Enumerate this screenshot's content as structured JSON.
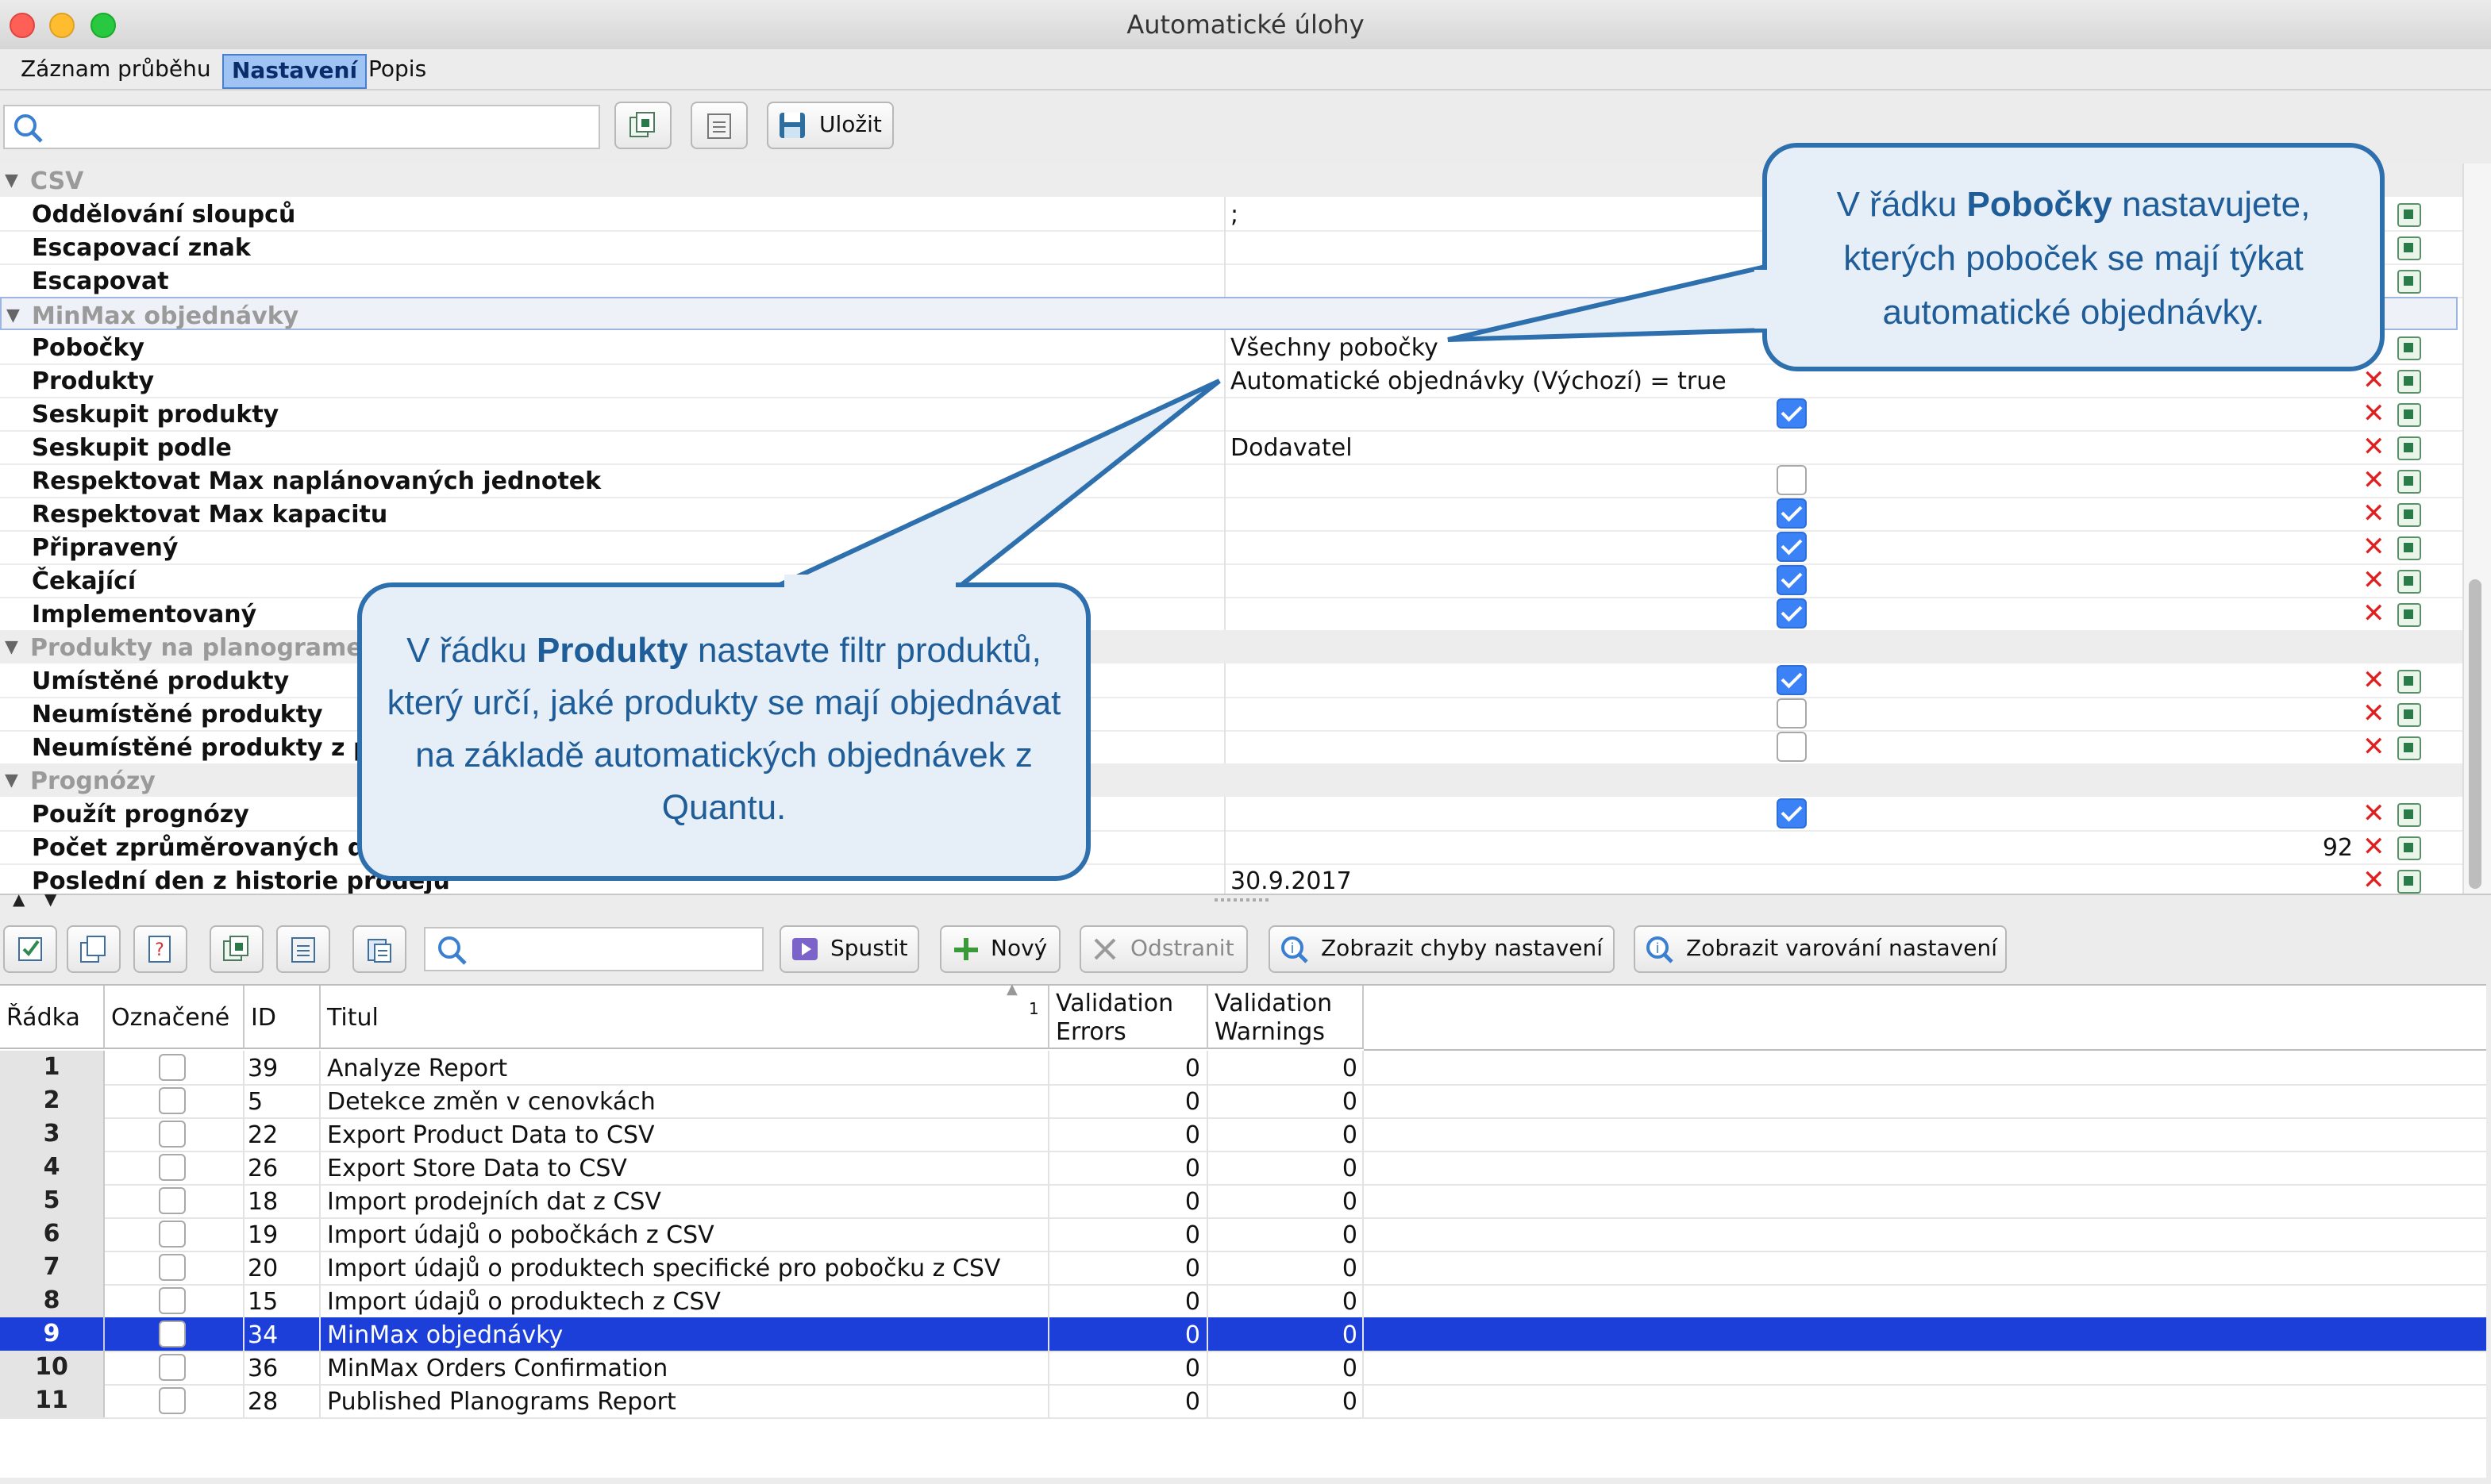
{
  "window": {
    "title": "Automatické úlohy"
  },
  "tabs": [
    {
      "label": "Záznam průběhu"
    },
    {
      "label": "Nastavení"
    },
    {
      "label": "Popis"
    }
  ],
  "toolbar1": {
    "save_label": "Uložit"
  },
  "settings": {
    "groups": {
      "csv": "CSV",
      "minmax": "MinMax objednávky",
      "planogram": "Produkty na planogrameč",
      "forecast": "Prognózy"
    },
    "rows": {
      "separator": {
        "name": "Oddělování sloupců",
        "value": ";"
      },
      "escape_char": {
        "name": "Escapovací znak"
      },
      "escape": {
        "name": "Escapovat"
      },
      "branches": {
        "name": "Pobočky",
        "value": "Všechny pobočky"
      },
      "products": {
        "name": "Produkty",
        "value": "Automatické objednávky (Výchozí) = true"
      },
      "group_products": {
        "name": "Seskupit produkty",
        "checked": true
      },
      "group_by": {
        "name": "Seskupit podle",
        "value": "Dodavatel"
      },
      "resp_max_planned": {
        "name": "Respektovat Max naplánovaných jednotek",
        "checked": false
      },
      "resp_max_cap": {
        "name": "Respektovat Max kapacitu",
        "checked": true
      },
      "prepared": {
        "name": "Připravený",
        "checked": true
      },
      "waiting": {
        "name": "Čekající",
        "checked": true
      },
      "implemented": {
        "name": "Implementovaný",
        "checked": true
      },
      "placed": {
        "name": "Umístěné produkty",
        "checked": true
      },
      "unplaced": {
        "name": "Neumístěné produkty",
        "checked": false
      },
      "unplaced_p": {
        "name": "Neumístěné produkty z p",
        "checked": false
      },
      "use_forecast": {
        "name": "Použít prognózy",
        "checked": true
      },
      "avg_count": {
        "name": "Počet zprůměrovaných dn",
        "value": "92"
      },
      "last_day": {
        "name": "Poslední den z historie prodejů",
        "value": "30.9.2017"
      }
    }
  },
  "callouts": {
    "branches": {
      "pre": "V řádku ",
      "bold": "Pobočky",
      "post": " nastavujete, kterých poboček se mají týkat automatické objednávky."
    },
    "products": {
      "pre": "V řádku ",
      "bold": "Produkty",
      "post": " nastavte filtr produktů, který určí, jaké produkty se mají objednávat na základě automatických objednávek z Quantu."
    }
  },
  "toolbar2": {
    "run_label": "Spustit",
    "new_label": "Nový",
    "delete_label": "Odstranit",
    "show_errors_label": "Zobrazit chyby nastavení",
    "show_warnings_label": "Zobrazit varování nastavení"
  },
  "table": {
    "headers": {
      "row": "Řádka",
      "marked": "Označené",
      "id": "ID",
      "title": "Titul",
      "sort_index": "1",
      "errors_1": "Validation",
      "errors_2": "Errors",
      "warnings_1": "Validation",
      "warnings_2": "Warnings"
    },
    "rows": [
      {
        "n": "1",
        "id": "39",
        "title": "Analyze Report",
        "err": "0",
        "warn": "0"
      },
      {
        "n": "2",
        "id": "5",
        "title": "Detekce změn v cenovkách",
        "err": "0",
        "warn": "0"
      },
      {
        "n": "3",
        "id": "22",
        "title": "Export Product Data to CSV",
        "err": "0",
        "warn": "0"
      },
      {
        "n": "4",
        "id": "26",
        "title": "Export Store Data to CSV",
        "err": "0",
        "warn": "0"
      },
      {
        "n": "5",
        "id": "18",
        "title": "Import prodejních dat z CSV",
        "err": "0",
        "warn": "0"
      },
      {
        "n": "6",
        "id": "19",
        "title": "Import údajů o pobočkách z CSV",
        "err": "0",
        "warn": "0"
      },
      {
        "n": "7",
        "id": "20",
        "title": "Import údajů o produktech specifické pro pobočku z CSV",
        "err": "0",
        "warn": "0"
      },
      {
        "n": "8",
        "id": "15",
        "title": "Import údajů o produktech z CSV",
        "err": "0",
        "warn": "0"
      },
      {
        "n": "9",
        "id": "34",
        "title": "MinMax objednávky",
        "err": "0",
        "warn": "0",
        "selected": true
      },
      {
        "n": "10",
        "id": "36",
        "title": "MinMax Orders Confirmation",
        "err": "0",
        "warn": "0"
      },
      {
        "n": "11",
        "id": "28",
        "title": "Published Planograms Report",
        "err": "0",
        "warn": "0"
      }
    ]
  },
  "colors": {
    "accent": "#3b82f6",
    "selection": "#1c3fd9",
    "callout_border": "#2e6fae",
    "delete_red": "#e02020"
  },
  "icons": [
    "search-icon",
    "save-icon",
    "delete-icon",
    "copy-icon",
    "run-icon",
    "plus-icon",
    "info-icon",
    "checkbox-icon"
  ]
}
